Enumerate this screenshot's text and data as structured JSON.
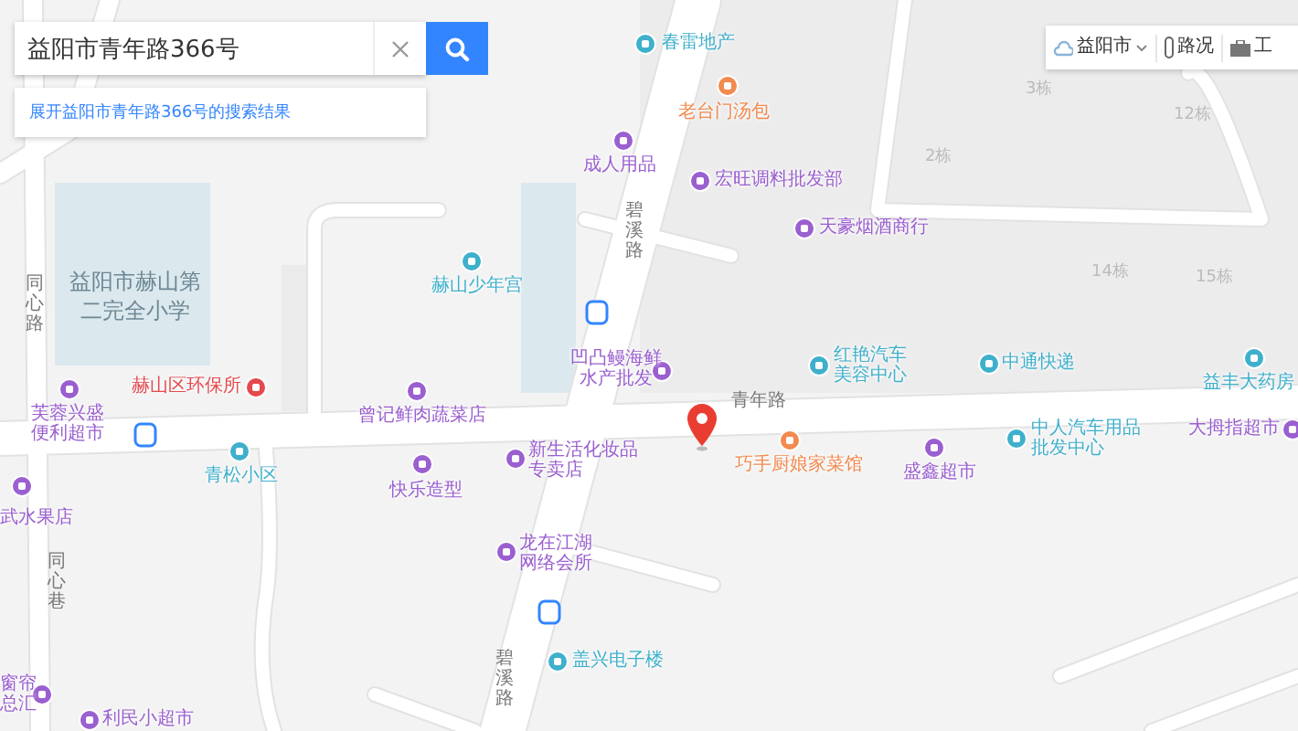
{
  "search": {
    "value": "益阳市青年路366号",
    "suggestion": "展开益阳市青年路366号的搜索结果"
  },
  "toolbar": [
    {
      "kind": "city",
      "label": "益阳市"
    },
    {
      "kind": "traffic",
      "label": "路况"
    },
    {
      "kind": "tools",
      "label": "工"
    }
  ],
  "areas": [
    {
      "name": "益阳市赫山第二完全小学"
    }
  ],
  "roads": [
    {
      "name": "同心路"
    },
    {
      "name": "同心巷"
    },
    {
      "name": "碧溪路"
    },
    {
      "name": "碧溪路"
    },
    {
      "name": "青年路"
    }
  ],
  "buildings": [
    {
      "name": "3栋"
    },
    {
      "name": "12栋"
    },
    {
      "name": "2栋"
    },
    {
      "name": "14栋"
    },
    {
      "name": "15栋"
    }
  ],
  "pois": [
    {
      "name": "春雷地产",
      "color": "#3fb0cc"
    },
    {
      "name": "老台门汤包",
      "color": "#f28a4e"
    },
    {
      "name": "成人用品",
      "color": "#9a5fd0"
    },
    {
      "name": "宏旺调料批发部",
      "color": "#9a5fd0"
    },
    {
      "name": "天豪烟酒商行",
      "color": "#9a5fd0"
    },
    {
      "name": "赫山少年宫",
      "color": "#3fb0cc"
    },
    {
      "name": "赫山区环保所",
      "color": "#e5484d"
    },
    {
      "name": "芙蓉兴盛便利超市",
      "color": "#9a5fd0"
    },
    {
      "name": "青松小区",
      "color": "#3fb0cc"
    },
    {
      "name": "曾记鲜肉蔬菜店",
      "color": "#9a5fd0"
    },
    {
      "name": "凹凸鳗海鲜水产批发",
      "color": "#9a5fd0"
    },
    {
      "name": "新生活化妆品专卖店",
      "color": "#9a5fd0"
    },
    {
      "name": "快乐造型",
      "color": "#9a5fd0"
    },
    {
      "name": "龙在江湖网络会所",
      "color": "#9a5fd0"
    },
    {
      "name": "盖兴电子楼",
      "color": "#3fb0cc"
    },
    {
      "name": "武水果店",
      "color": "#9a5fd0"
    },
    {
      "name": "窗帘总汇",
      "color": "#9a5fd0"
    },
    {
      "name": "利民小超市",
      "color": "#9a5fd0"
    },
    {
      "name": "红艳汽车美容中心",
      "color": "#3fb0cc"
    },
    {
      "name": "中通快递",
      "color": "#3fb0cc"
    },
    {
      "name": "益丰大药房",
      "color": "#3fb0cc"
    },
    {
      "name": "巧手厨娘家菜馆",
      "color": "#f28a4e"
    },
    {
      "name": "盛鑫超市",
      "color": "#9a5fd0"
    },
    {
      "name": "中人汽车用品批发中心",
      "color": "#3fb0cc"
    },
    {
      "name": "大拇指超市",
      "color": "#9a5fd0"
    }
  ]
}
